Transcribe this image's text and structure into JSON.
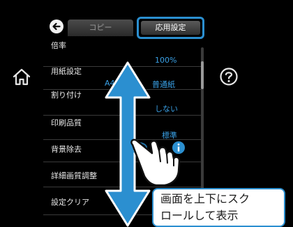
{
  "top_bar": {
    "tab_copy_label": "コピー",
    "tab_advanced_label": "応用設定"
  },
  "settings_list": [
    {
      "label": "倍率",
      "value": "100%"
    },
    {
      "label": "用紙設定",
      "value": "普通紙",
      "extra": "A4"
    },
    {
      "label": "割り付け",
      "value": "しない"
    },
    {
      "label": "印刷品質",
      "value": "標準"
    },
    {
      "label": "背景除去",
      "value": ""
    },
    {
      "label": "詳細画質調整",
      "value": ""
    },
    {
      "label": "設定クリア",
      "value": ""
    }
  ],
  "callout": {
    "line1": "画面を上下にスク",
    "line2": "ロールして表示"
  },
  "icons": {
    "home": "home-icon",
    "help": "help-icon",
    "back": "back-arrow-icon",
    "info": "info-icon",
    "scroll_hint": "vertical-double-arrow-icon",
    "hand": "pointing-hand-icon"
  },
  "colors": {
    "accent_blue": "#2b8fd0",
    "value_blue": "#3aa1e6",
    "background": "#000000"
  }
}
